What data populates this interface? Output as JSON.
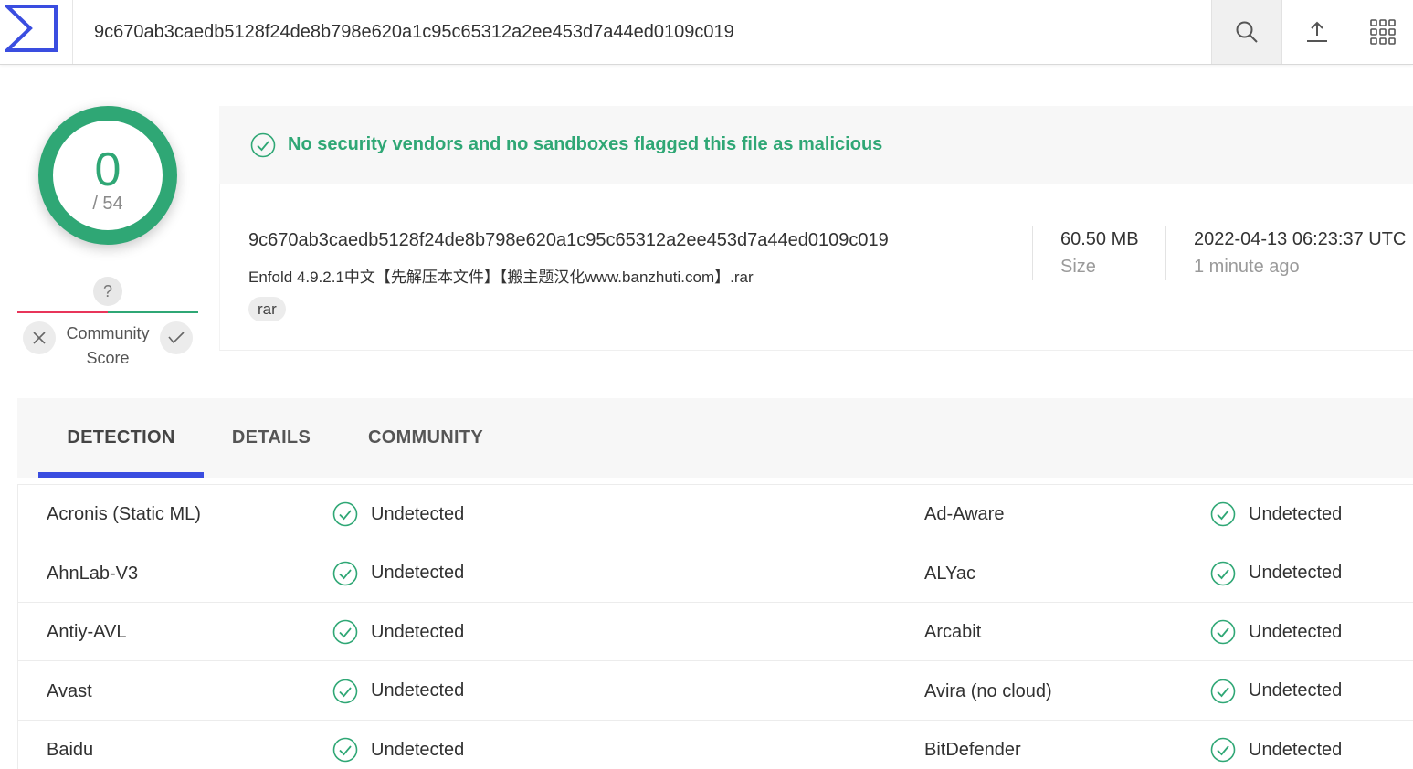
{
  "header": {
    "logo_icon": "virustotal-sigma-logo",
    "search_value": "9c670ab3caedb5128f24de8b798e620a1c95c65312a2ee453d7a44ed0109c019",
    "search_icon": "search-icon",
    "upload_icon": "upload-icon",
    "apps_icon": "apps-grid-icon"
  },
  "score": {
    "detections": "0",
    "total": "/ 54",
    "color": "#2fa775"
  },
  "community_score": {
    "question_mark": "?",
    "label_line1": "Community",
    "label_line2": "Score",
    "negative_color": "#e8355a",
    "positive_color": "#2fa775"
  },
  "verdict": {
    "text": "No security vendors and no sandboxes flagged this file as malicious",
    "icon": "check-circle-icon",
    "color": "#2fa775"
  },
  "file": {
    "hash": "9c670ab3caedb5128f24de8b798e620a1c95c65312a2ee453d7a44ed0109c019",
    "name": "Enfold 4.9.2.1中文【先解压本文件】【搬主题汉化www.banzhuti.com】.rar",
    "tag": "rar",
    "size_value": "60.50 MB",
    "size_label": "Size",
    "date_value": "2022-04-13 06:23:37 UTC",
    "date_relative": "1 minute ago"
  },
  "tabs": {
    "detection": "DETECTION",
    "details": "DETAILS",
    "community": "COMMUNITY",
    "active": "DETECTION",
    "accent": "#3a4de0"
  },
  "results": [
    {
      "left_engine": "Acronis (Static ML)",
      "left_result": "Undetected",
      "right_engine": "Ad-Aware",
      "right_result": "Undetected"
    },
    {
      "left_engine": "AhnLab-V3",
      "left_result": "Undetected",
      "right_engine": "ALYac",
      "right_result": "Undetected"
    },
    {
      "left_engine": "Antiy-AVL",
      "left_result": "Undetected",
      "right_engine": "Arcabit",
      "right_result": "Undetected"
    },
    {
      "left_engine": "Avast",
      "left_result": "Undetected",
      "right_engine": "Avira (no cloud)",
      "right_result": "Undetected"
    },
    {
      "left_engine": "Baidu",
      "left_result": "Undetected",
      "right_engine": "BitDefender",
      "right_result": "Undetected"
    }
  ]
}
